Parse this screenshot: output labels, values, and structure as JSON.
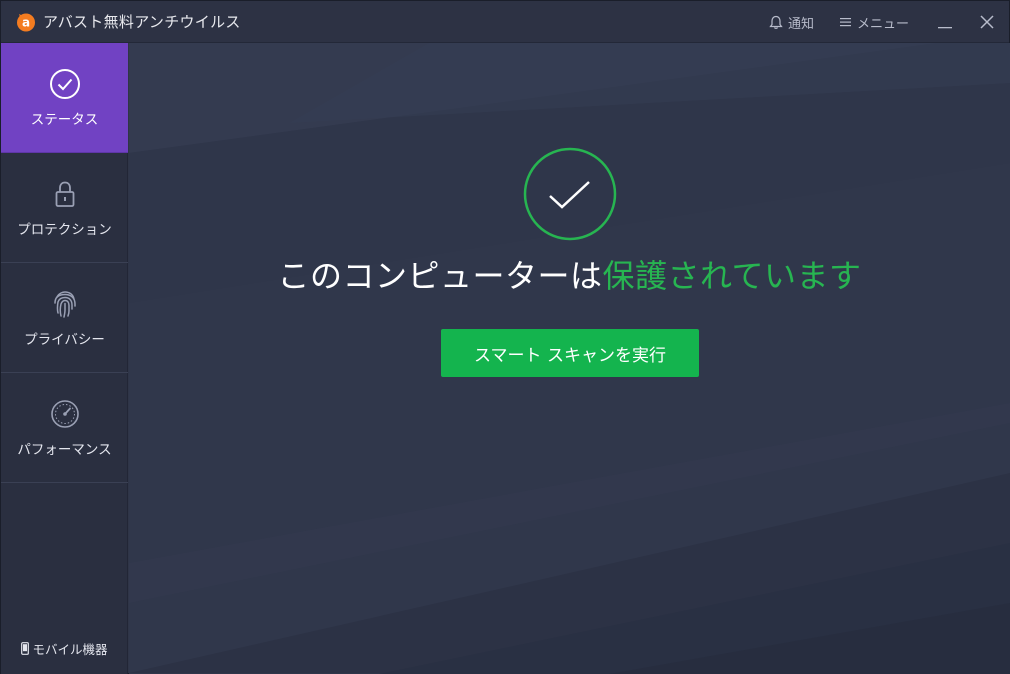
{
  "app": {
    "title": "アバスト無料アンチウイルス"
  },
  "titlebar": {
    "notifications_label": "通知",
    "menu_label": "メニュー"
  },
  "sidebar": {
    "items": [
      {
        "label": "ステータス",
        "icon": "check-circle-icon",
        "active": true
      },
      {
        "label": "プロテクション",
        "icon": "lock-icon",
        "active": false
      },
      {
        "label": "プライバシー",
        "icon": "fingerprint-icon",
        "active": false
      },
      {
        "label": "パフォーマンス",
        "icon": "speedometer-icon",
        "active": false
      }
    ],
    "mobile_label": "モバイル機器"
  },
  "main": {
    "status_prefix": "このコンピューターは",
    "status_highlight": "保護されています",
    "scan_button": "スマート スキャンを実行"
  },
  "colors": {
    "accent_purple": "#7142c3",
    "status_green": "#27b551",
    "button_green": "#14b44e",
    "logo_orange": "#f47c20"
  }
}
